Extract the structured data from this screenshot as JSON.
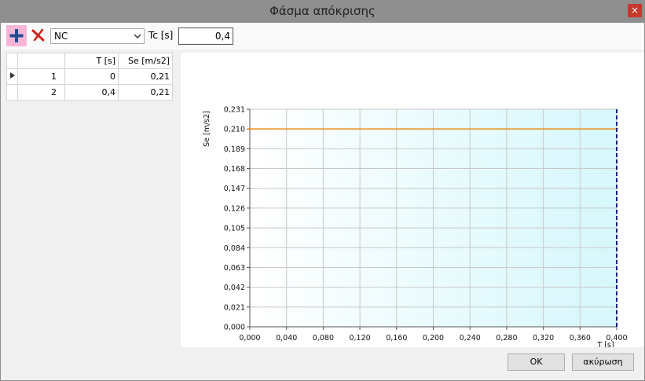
{
  "window": {
    "title": "Φάσμα απόκρισης",
    "close_label": "×"
  },
  "toolbar": {
    "add_icon": "plus-icon",
    "delete_icon": "red-x-icon",
    "combo_value": "NC",
    "tc_label": "Tc  [s]",
    "tc_value": "0,4"
  },
  "table": {
    "columns": [
      "T [s]",
      "Se [m/s2]"
    ],
    "rows": [
      {
        "num": "1",
        "t": "0",
        "se": "0,21",
        "current": true
      },
      {
        "num": "2",
        "t": "0,4",
        "se": "0,21",
        "current": false
      }
    ]
  },
  "chart_data": {
    "type": "line",
    "xlabel": "T [s]",
    "ylabel": "Se [m/s2]",
    "xlim": [
      0,
      0.4
    ],
    "ylim": [
      0,
      0.231
    ],
    "xticks": [
      "0,000",
      "0,040",
      "0,080",
      "0,120",
      "0,160",
      "0,200",
      "0,240",
      "0,280",
      "0,320",
      "0,360",
      "0,400"
    ],
    "yticks": [
      "0,000",
      "0,021",
      "0,042",
      "0,063",
      "0,084",
      "0,105",
      "0,126",
      "0,147",
      "0,168",
      "0,189",
      "0,210",
      "0,231"
    ],
    "grid": true,
    "series": [
      {
        "x": [
          0,
          0.4
        ],
        "y": [
          0.21,
          0.21
        ],
        "color": "#e8901c"
      }
    ],
    "marker_line": {
      "x": 0.4,
      "color": "#0a1f7a",
      "style": "dashed"
    },
    "background_colors": [
      "#ffffff",
      "#d6f7fb"
    ]
  },
  "buttons": {
    "ok": "OK",
    "cancel": "ακύρωση"
  }
}
